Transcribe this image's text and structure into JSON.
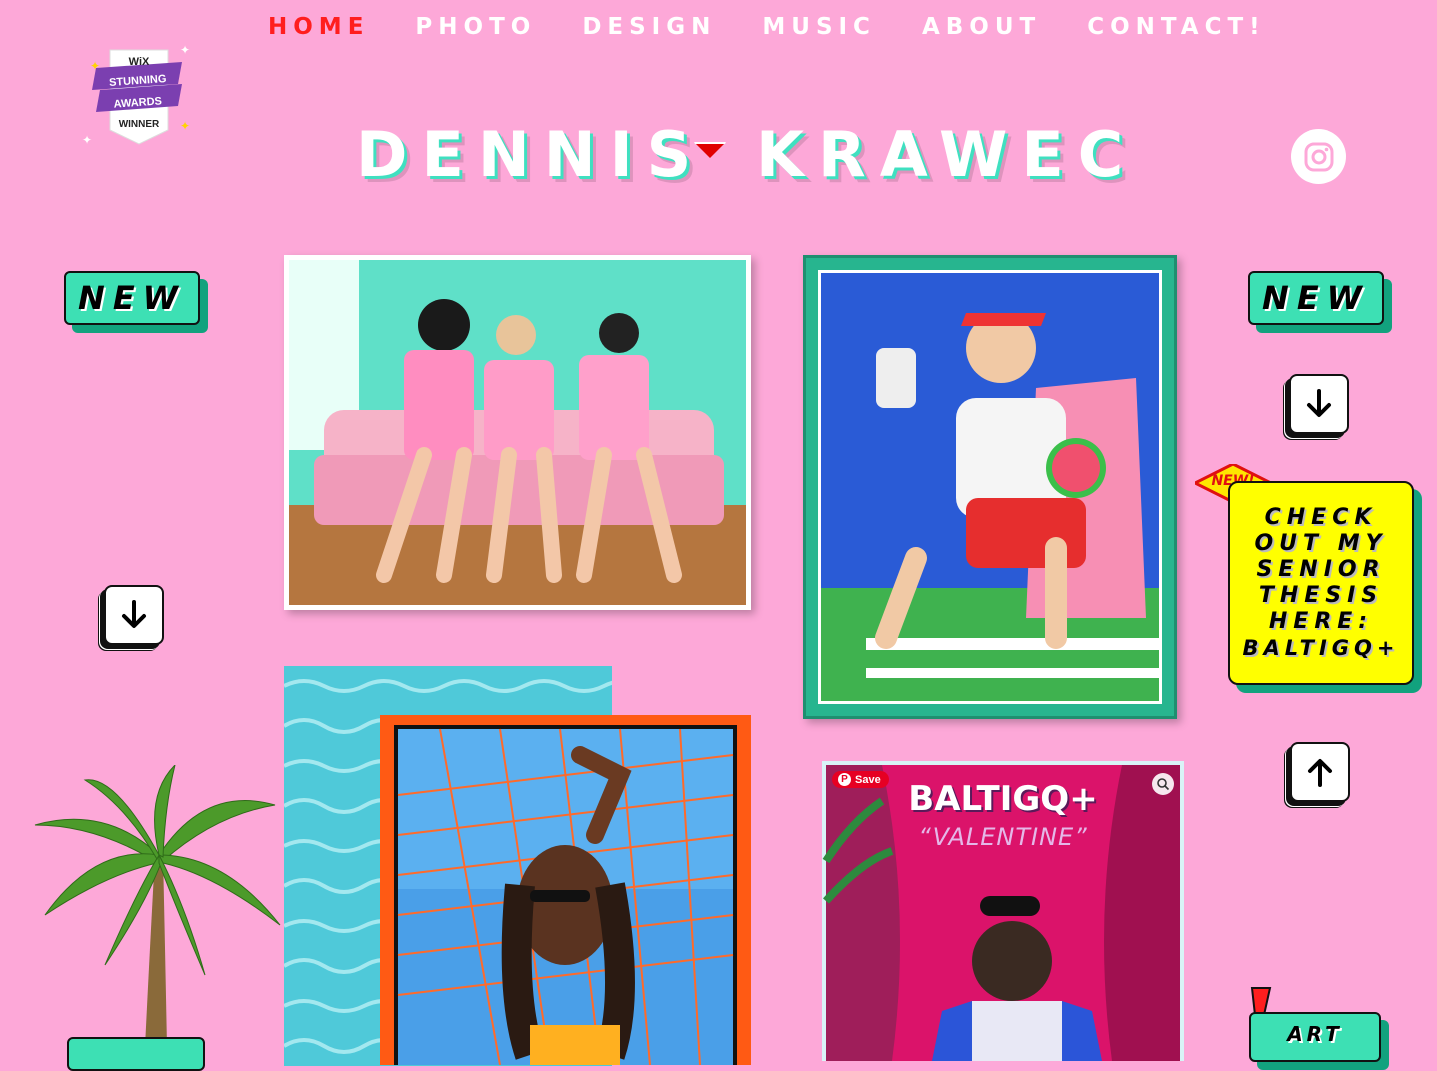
{
  "nav": {
    "items": [
      {
        "label": "HOME",
        "active": true
      },
      {
        "label": "PHOTO",
        "active": false
      },
      {
        "label": "DESIGN",
        "active": false
      },
      {
        "label": "MUSIC",
        "active": false
      },
      {
        "label": "ABOUT",
        "active": false
      },
      {
        "label": "CONTACT!",
        "active": false
      }
    ]
  },
  "header": {
    "first_name": "DENNIS",
    "last_name": "KRAWEC"
  },
  "award": {
    "brand": "WiX",
    "line1": "STUNNING",
    "line2": "AWARDS",
    "line3": "WINNER"
  },
  "badges": {
    "new_left": "NEW",
    "new_right": "NEW",
    "new_sticker": "NEW!"
  },
  "thesis": {
    "lines": [
      "CHECK",
      "OUT MY",
      "SENIOR",
      "THESIS",
      "HERE:",
      "BALTIGQ+"
    ]
  },
  "album": {
    "title": "BALTIGQ+",
    "subtitle": "“VALENTINE”",
    "pin_label": "Save"
  },
  "art_button": "ART",
  "icons": [
    "instagram-icon",
    "arrow-down-icon",
    "arrow-up-icon",
    "dropdown-triangle-icon",
    "palm-tree-icon",
    "exclamation-icon"
  ],
  "colors": {
    "background": "#FDA8D8",
    "accent_teal": "#3DE0B4",
    "active_nav": "#FF1E1E",
    "thesis_yellow": "#FFFF00"
  }
}
